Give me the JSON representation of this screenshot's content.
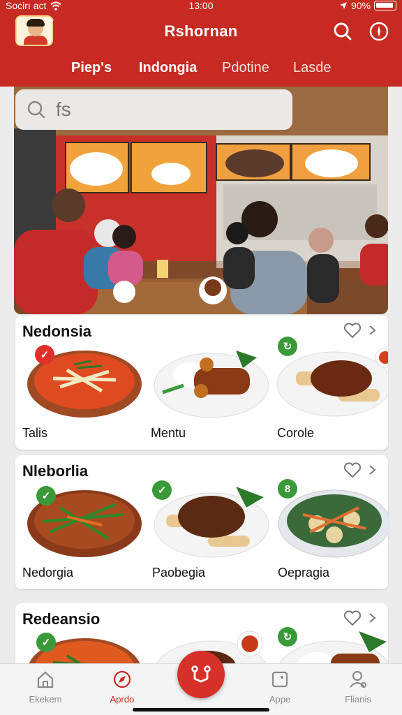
{
  "status_bar": {
    "carrier": "Socirı act",
    "time": "13:00",
    "battery": "90%"
  },
  "header": {
    "title": "Rshornan",
    "logo_icon": "chef-mascot-logo",
    "logo_reg": "®",
    "search_icon": "search-icon",
    "action_icon": "compass-icon",
    "tabs": [
      "Piep's",
      "Indongia",
      "Pdotine",
      "Lasde"
    ],
    "active_tab": 1,
    "brand_color": "#c62a22"
  },
  "search": {
    "value": "fs"
  },
  "sections": [
    {
      "title": "Nedonsia",
      "items": [
        {
          "label": "Talis",
          "badge": "✓",
          "badge_color": "#e0302b"
        },
        {
          "label": "Mentu",
          "badge": "",
          "badge_color": ""
        },
        {
          "label": "Corole",
          "badge": "↻",
          "badge_color": "#3a9a3a"
        }
      ]
    },
    {
      "title": "Nleborlia",
      "items": [
        {
          "label": "Nedorgia",
          "badge": "✓",
          "badge_color": "#3a9a3a"
        },
        {
          "label": "Paobegia",
          "badge": "✓",
          "badge_color": "#3a9a3a"
        },
        {
          "label": "Oepragia",
          "badge": "8",
          "badge_color": "#3a9a3a"
        }
      ]
    },
    {
      "title": "Redeansio",
      "items": [
        {
          "label": "",
          "badge": "✓",
          "badge_color": "#3a9a3a"
        },
        {
          "label": "",
          "badge": "",
          "badge_color": ""
        },
        {
          "label": "",
          "badge": "↻",
          "badge_color": "#3a9a3a"
        }
      ]
    }
  ],
  "bottom_nav": [
    {
      "label": "Ekekem",
      "icon": "home-icon"
    },
    {
      "label": "Aprdo",
      "icon": "compass-icon"
    },
    {
      "label": "Appe",
      "icon": "app-icon"
    },
    {
      "label": "Flianis",
      "icon": "profile-icon"
    }
  ],
  "bottom_nav_active": 1
}
